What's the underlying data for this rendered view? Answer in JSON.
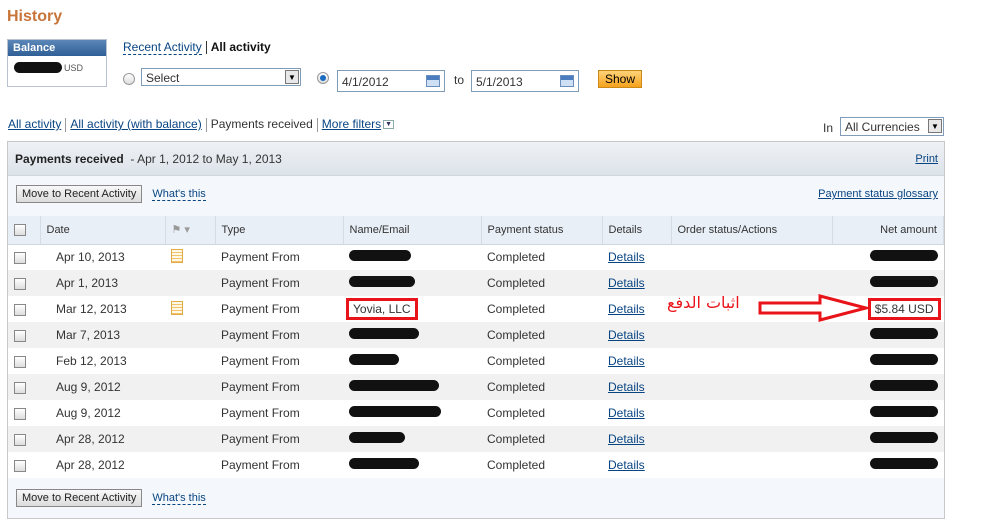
{
  "page": {
    "title": "History"
  },
  "balance": {
    "label": "Balance",
    "currency": "USD"
  },
  "top_links": {
    "recent": "Recent Activity",
    "all": "All activity"
  },
  "filter_row": {
    "select_value": "Select",
    "from_date": "4/1/2012",
    "to_label": "to",
    "to_date": "5/1/2013",
    "show_label": "Show"
  },
  "filters": {
    "all_activity": "All activity",
    "all_with_balance": "All activity (with balance)",
    "payments_received": "Payments received",
    "more_filters": "More filters",
    "in_label": "In",
    "currency": "All Currencies"
  },
  "panel": {
    "title": "Payments received",
    "range": "- Apr 1, 2012 to May 1, 2013",
    "print": "Print",
    "move_button": "Move to Recent Activity",
    "whats_this": "What's this",
    "glossary": "Payment status glossary"
  },
  "table": {
    "headers": [
      "Date",
      "Type",
      "Name/Email",
      "Payment status",
      "Details",
      "Order status/Actions",
      "Net amount"
    ],
    "rows": [
      {
        "date": "Apr 10, 2013",
        "note": true,
        "type": "Payment From",
        "name": "",
        "status": "Completed",
        "details": "Details",
        "amount": ""
      },
      {
        "date": "Apr 1, 2013",
        "note": false,
        "type": "Payment From",
        "name": "",
        "status": "Completed",
        "details": "Details",
        "amount": ""
      },
      {
        "date": "Mar 12, 2013",
        "note": true,
        "type": "Payment From",
        "name": "Yovia, LLC",
        "status": "Completed",
        "details": "Details",
        "amount": "$5.84 USD"
      },
      {
        "date": "Mar 7, 2013",
        "note": false,
        "type": "Payment From",
        "name": "",
        "status": "Completed",
        "details": "Details",
        "amount": ""
      },
      {
        "date": "Feb 12, 2013",
        "note": false,
        "type": "Payment From",
        "name": "",
        "status": "Completed",
        "details": "Details",
        "amount": ""
      },
      {
        "date": "Aug 9, 2012",
        "note": false,
        "type": "Payment From",
        "name": "",
        "status": "Completed",
        "details": "Details",
        "amount": ""
      },
      {
        "date": "Aug 9, 2012",
        "note": false,
        "type": "Payment From",
        "name": "",
        "status": "Completed",
        "details": "Details",
        "amount": ""
      },
      {
        "date": "Apr 28, 2012",
        "note": false,
        "type": "Payment From",
        "name": "",
        "status": "Completed",
        "details": "Details",
        "amount": ""
      },
      {
        "date": "Apr 28, 2012",
        "note": false,
        "type": "Payment From",
        "name": "",
        "status": "Completed",
        "details": "Details",
        "amount": ""
      }
    ]
  },
  "annotation": {
    "text": "اثبات الدفع",
    "color": "#e8141a"
  }
}
